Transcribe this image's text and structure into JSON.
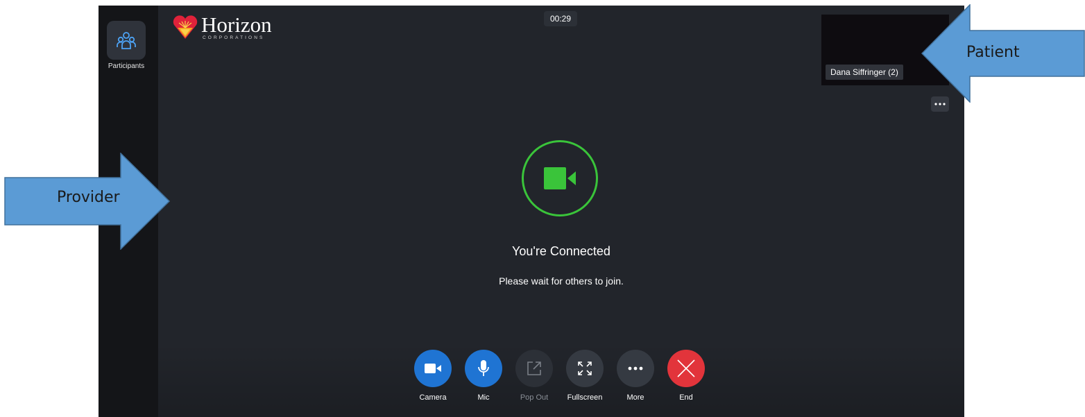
{
  "sidebar": {
    "participants_label": "Participants"
  },
  "logo": {
    "word": "Horizon",
    "sub": "CORPORATIONS"
  },
  "timer": "00:29",
  "patient_tile": {
    "name": "Dana Siffringer (2)"
  },
  "status": {
    "title": "You're Connected",
    "subtitle": "Please wait for others to join."
  },
  "controls": [
    {
      "label": "Camera"
    },
    {
      "label": "Mic"
    },
    {
      "label": "Pop Out"
    },
    {
      "label": "Fullscreen"
    },
    {
      "label": "More"
    },
    {
      "label": "End"
    }
  ],
  "annotations": {
    "provider": "Provider",
    "patient": "Patient"
  },
  "colors": {
    "app_bg": "#22252b",
    "sidebar_bg": "#141518",
    "accent_blue": "#1f74d3",
    "connected_green": "#3ac43a",
    "end_red": "#e2343b",
    "callout_blue": "#5b9bd5"
  },
  "icons": {
    "participants": "participants-icon",
    "camera": "video-camera-icon",
    "mic": "microphone-icon",
    "popout": "external-link-icon",
    "fullscreen": "fullscreen-icon",
    "more": "ellipsis-icon",
    "end": "close-icon"
  }
}
